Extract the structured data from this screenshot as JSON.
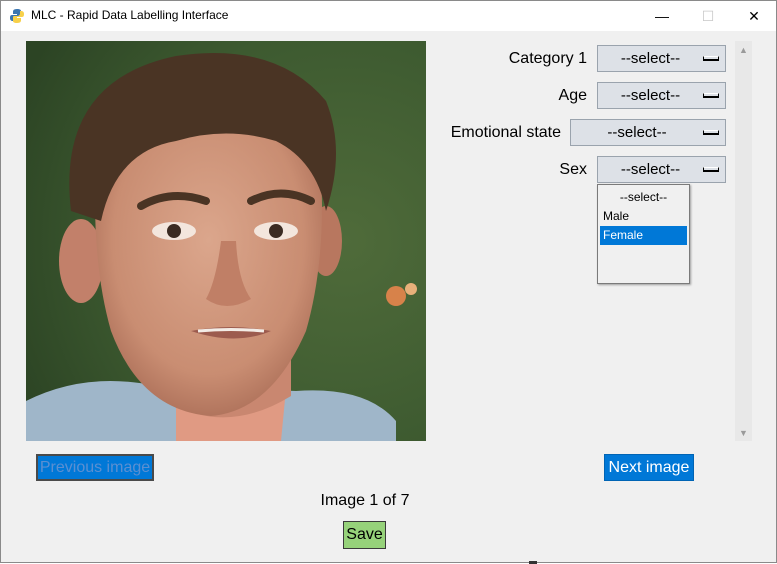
{
  "window": {
    "title": "MLC - Rapid Data Labelling Interface",
    "controls": {
      "minimize": "—",
      "maximize": "☐",
      "close": "✕"
    }
  },
  "fields": [
    {
      "label": "Category 1",
      "value": "--select--"
    },
    {
      "label": "Age",
      "value": "--select--"
    },
    {
      "label": "Emotional state",
      "value": "--select--"
    },
    {
      "label": "Sex",
      "value": "--select--"
    }
  ],
  "sex_dropdown": {
    "options": [
      "--select--",
      "Male",
      "Female"
    ],
    "highlighted": "Female"
  },
  "buttons": {
    "previous": "Previous image",
    "next": "Next image",
    "save": "Save"
  },
  "counter": "Image 1 of 7",
  "colors": {
    "accent": "#0078d7",
    "save": "#96d27a",
    "dropdown_bg": "#dde1e7"
  }
}
